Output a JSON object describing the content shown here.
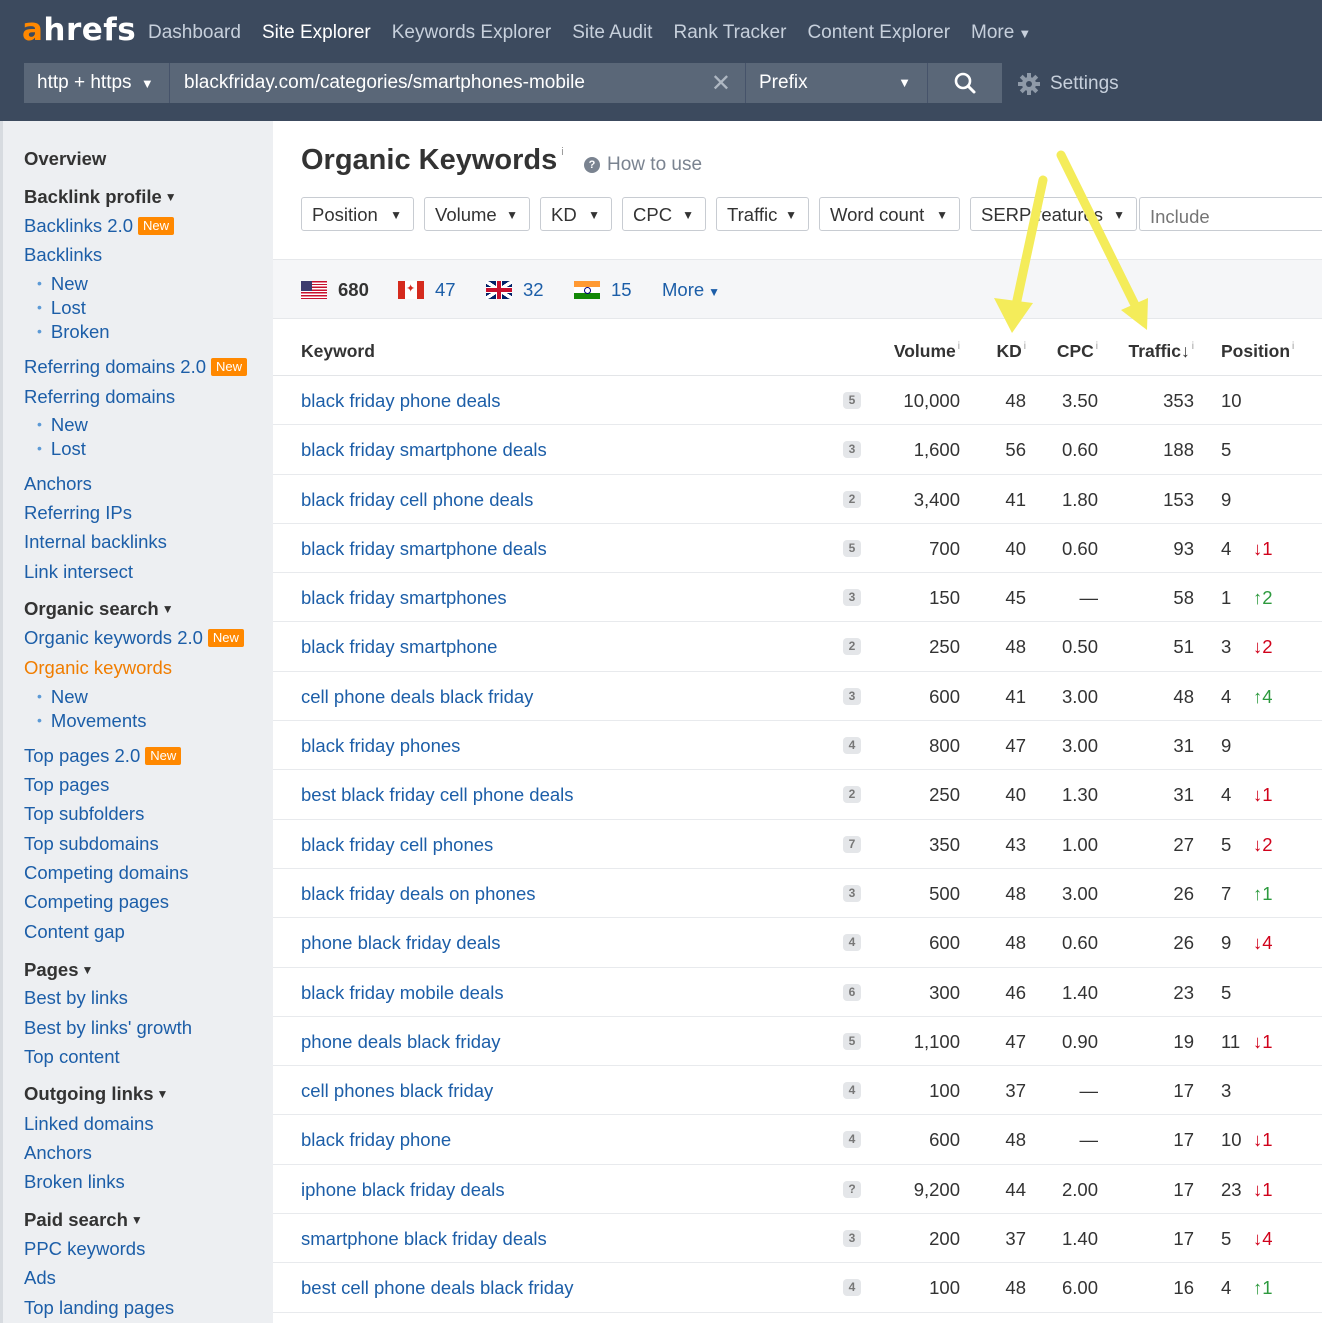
{
  "logo": {
    "a": "a",
    "rest": "hrefs"
  },
  "nav": {
    "items": [
      {
        "label": "Dashboard",
        "active": false
      },
      {
        "label": "Site Explorer",
        "active": true
      },
      {
        "label": "Keywords Explorer",
        "active": false
      },
      {
        "label": "Site Audit",
        "active": false
      },
      {
        "label": "Rank Tracker",
        "active": false
      },
      {
        "label": "Content Explorer",
        "active": false
      }
    ],
    "more": "More"
  },
  "search": {
    "protocol": "http + https",
    "url": "blackfriday.com/categories/smartphones-mobile",
    "mode": "Prefix",
    "settings": "Settings"
  },
  "sidebar": {
    "overview": "Overview",
    "backlink_profile": "Backlink profile",
    "backlinks_2": "Backlinks 2.0",
    "new_badge": "New",
    "backlinks": "Backlinks",
    "bl_new": "New",
    "bl_lost": "Lost",
    "bl_broken": "Broken",
    "refdomains_2": "Referring domains 2.0",
    "refdomains": "Referring domains",
    "rd_new": "New",
    "rd_lost": "Lost",
    "anchors": "Anchors",
    "ref_ips": "Referring IPs",
    "internal_backlinks": "Internal backlinks",
    "link_intersect": "Link intersect",
    "organic_search": "Organic search",
    "organic_keywords_2": "Organic keywords 2.0",
    "organic_keywords": "Organic keywords",
    "ok_new": "New",
    "ok_movements": "Movements",
    "top_pages_2": "Top pages 2.0",
    "top_pages": "Top pages",
    "top_subfolders": "Top subfolders",
    "top_subdomains": "Top subdomains",
    "competing_domains": "Competing domains",
    "competing_pages": "Competing pages",
    "content_gap": "Content gap",
    "pages": "Pages",
    "best_by_links": "Best by links",
    "best_by_links_growth": "Best by links' growth",
    "top_content": "Top content",
    "outgoing_links": "Outgoing links",
    "linked_domains": "Linked domains",
    "out_anchors": "Anchors",
    "broken_links": "Broken links",
    "paid_search": "Paid search",
    "ppc_keywords": "PPC keywords",
    "ads": "Ads",
    "top_landing_pages": "Top landing pages"
  },
  "main": {
    "title": "Organic Keywords",
    "info": "i",
    "how_to_use": "How to use",
    "filters": [
      "Position",
      "Volume",
      "KD",
      "CPC",
      "Traffic",
      "Word count",
      "SERP features"
    ],
    "include_placeholder": "Include",
    "countries": [
      {
        "flag": "us-flag-icon",
        "count": "680"
      },
      {
        "flag": "ca-flag-icon",
        "count": "47"
      },
      {
        "flag": "uk-flag-icon",
        "count": "32"
      },
      {
        "flag": "in-flag-icon",
        "count": "15"
      }
    ],
    "more": "More",
    "columns": {
      "keyword": "Keyword",
      "volume": "Volume",
      "kd": "KD",
      "cpc": "CPC",
      "traffic": "Traffic",
      "sort_arrow": "↓",
      "position": "Position",
      "info": "i"
    },
    "rows": [
      {
        "keyword": "black friday phone deals",
        "serp": "5",
        "volume": "10,000",
        "kd": "48",
        "cpc": "3.50",
        "traffic": "353",
        "position": "10",
        "change": "",
        "dir": ""
      },
      {
        "keyword": "black friday smartphone deals",
        "serp": "3",
        "volume": "1,600",
        "kd": "56",
        "cpc": "0.60",
        "traffic": "188",
        "position": "5",
        "change": "",
        "dir": ""
      },
      {
        "keyword": "black friday cell phone deals",
        "serp": "2",
        "volume": "3,400",
        "kd": "41",
        "cpc": "1.80",
        "traffic": "153",
        "position": "9",
        "change": "",
        "dir": ""
      },
      {
        "keyword": "black friday smartphone deals",
        "serp": "5",
        "volume": "700",
        "kd": "40",
        "cpc": "0.60",
        "traffic": "93",
        "position": "4",
        "change": "↓1",
        "dir": "down"
      },
      {
        "keyword": "black friday smartphones",
        "serp": "3",
        "volume": "150",
        "kd": "45",
        "cpc": "—",
        "traffic": "58",
        "position": "1",
        "change": "↑2",
        "dir": "up"
      },
      {
        "keyword": "black friday smartphone",
        "serp": "2",
        "volume": "250",
        "kd": "48",
        "cpc": "0.50",
        "traffic": "51",
        "position": "3",
        "change": "↓2",
        "dir": "down"
      },
      {
        "keyword": "cell phone deals black friday",
        "serp": "3",
        "volume": "600",
        "kd": "41",
        "cpc": "3.00",
        "traffic": "48",
        "position": "4",
        "change": "↑4",
        "dir": "up"
      },
      {
        "keyword": "black friday phones",
        "serp": "4",
        "volume": "800",
        "kd": "47",
        "cpc": "3.00",
        "traffic": "31",
        "position": "9",
        "change": "",
        "dir": ""
      },
      {
        "keyword": "best black friday cell phone deals",
        "serp": "2",
        "volume": "250",
        "kd": "40",
        "cpc": "1.30",
        "traffic": "31",
        "position": "4",
        "change": "↓1",
        "dir": "down"
      },
      {
        "keyword": "black friday cell phones",
        "serp": "7",
        "volume": "350",
        "kd": "43",
        "cpc": "1.00",
        "traffic": "27",
        "position": "5",
        "change": "↓2",
        "dir": "down"
      },
      {
        "keyword": "black friday deals on phones",
        "serp": "3",
        "volume": "500",
        "kd": "48",
        "cpc": "3.00",
        "traffic": "26",
        "position": "7",
        "change": "↑1",
        "dir": "up"
      },
      {
        "keyword": "phone black friday deals",
        "serp": "4",
        "volume": "600",
        "kd": "48",
        "cpc": "0.60",
        "traffic": "26",
        "position": "9",
        "change": "↓4",
        "dir": "down"
      },
      {
        "keyword": "black friday mobile deals",
        "serp": "6",
        "volume": "300",
        "kd": "46",
        "cpc": "1.40",
        "traffic": "23",
        "position": "5",
        "change": "",
        "dir": ""
      },
      {
        "keyword": "phone deals black friday",
        "serp": "5",
        "volume": "1,100",
        "kd": "47",
        "cpc": "0.90",
        "traffic": "19",
        "position": "11",
        "change": "↓1",
        "dir": "down"
      },
      {
        "keyword": "cell phones black friday",
        "serp": "4",
        "volume": "100",
        "kd": "37",
        "cpc": "—",
        "traffic": "17",
        "position": "3",
        "change": "",
        "dir": ""
      },
      {
        "keyword": "black friday phone",
        "serp": "4",
        "volume": "600",
        "kd": "48",
        "cpc": "—",
        "traffic": "17",
        "position": "10",
        "change": "↓1",
        "dir": "down"
      },
      {
        "keyword": "iphone black friday deals",
        "serp": "?",
        "volume": "9,200",
        "kd": "44",
        "cpc": "2.00",
        "traffic": "17",
        "position": "23",
        "change": "↓1",
        "dir": "down"
      },
      {
        "keyword": "smartphone black friday deals",
        "serp": "3",
        "volume": "200",
        "kd": "37",
        "cpc": "1.40",
        "traffic": "17",
        "position": "5",
        "change": "↓4",
        "dir": "down"
      },
      {
        "keyword": "best cell phone deals black friday",
        "serp": "4",
        "volume": "100",
        "kd": "48",
        "cpc": "6.00",
        "traffic": "16",
        "position": "4",
        "change": "↑1",
        "dir": "up"
      }
    ]
  },
  "colors": {
    "topbar": "#3c4a5e",
    "link": "#1c5ea8",
    "accent": "#ff8800",
    "down": "#d0021b",
    "up": "#2d9a3e",
    "arrow": "#f4ec5a"
  }
}
